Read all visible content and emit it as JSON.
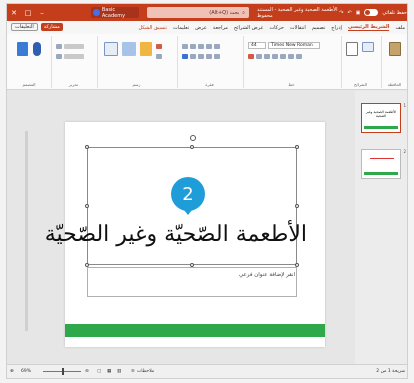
{
  "titlebar": {
    "app_label": "Basic Academy",
    "search_placeholder": "(Alt+Q) بحث",
    "doc_title": "الأطعمة الصحية وغير الصحية - المستند محفوظ",
    "right_label": "حفظ تلقائي"
  },
  "ribbon": {
    "tabs": [
      "ملف",
      "الشريط الرئيسي",
      "إدراج",
      "تصميم",
      "انتقالات",
      "حركات",
      "عرض الشرائح",
      "مراجعة",
      "عرض",
      "تعليمات",
      "تنسيق الشكل"
    ],
    "share_label": "مشاركة",
    "comments_label": "التعليقات",
    "groups": {
      "clipboard": "الحافظة",
      "slides": "الشرائح",
      "font": "خط",
      "paragraph": "فقرة",
      "drawing": "رسم",
      "editing": "تحرير",
      "voice": "صوت",
      "designer": "المصمم"
    },
    "font_name": "Times New Roman",
    "font_size": "44"
  },
  "slide": {
    "number": "2",
    "title": "الأطعمة الصّحيّة وغير الصّحيّة",
    "subtitle_placeholder": "انقر لإضافة عنوان فرعي"
  },
  "thumbnails": [
    {
      "num": "1",
      "text": "الأطعمة الصحية وغير الصحية"
    },
    {
      "num": "2",
      "text": ""
    }
  ],
  "status": {
    "slide_info": "شريحة 1 من 2",
    "notes_label": "ملاحظات",
    "zoom": "69%"
  },
  "colors": {
    "accent": "#c43e1c",
    "badge": "#1e9dd9",
    "green_bar": "#2fa84a"
  }
}
